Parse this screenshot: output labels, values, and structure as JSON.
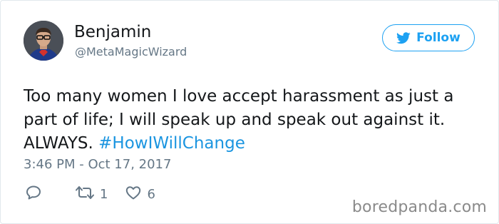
{
  "user": {
    "name": "Benjamin",
    "handle": "@MetaMagicWizard"
  },
  "follow_button": {
    "label": "Follow",
    "icon": "twitter-bird-icon"
  },
  "tweet": {
    "text_line1": "Too many women I love accept harassment as just a",
    "text_line2": "part of life; I will speak up and speak out against it.",
    "text_line3_prefix": "ALWAYS. ",
    "hashtag": "#HowIWillChange",
    "timestamp": "3:46 PM - Oct 17, 2017"
  },
  "actions": {
    "reply_icon": "reply-icon",
    "retweet_icon": "retweet-icon",
    "retweet_count": "1",
    "like_icon": "heart-icon",
    "like_count": "6"
  },
  "watermark": "boredpanda.com",
  "colors": {
    "accent": "#1da1f2",
    "hashtag": "#1b95e0",
    "secondary_text": "#657786",
    "primary_text": "#14171a"
  }
}
